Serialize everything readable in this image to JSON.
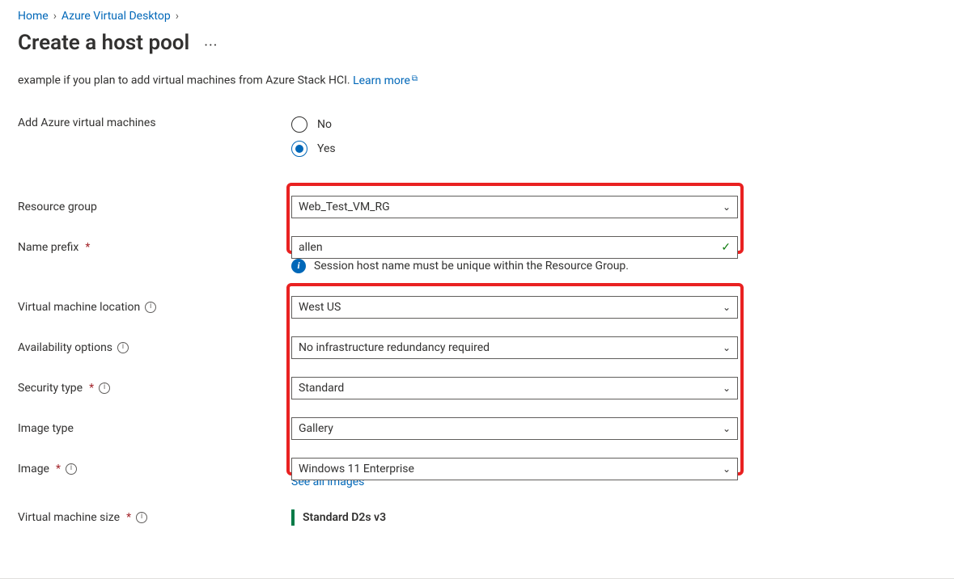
{
  "breadcrumb": {
    "home": "Home",
    "avd": "Azure Virtual Desktop"
  },
  "page_title": "Create a host pool",
  "description": {
    "text": "example if you plan to add virtual machines from Azure Stack HCI. ",
    "link": "Learn more"
  },
  "labels": {
    "add_vms": "Add Azure virtual machines",
    "resource_group": "Resource group",
    "name_prefix": "Name prefix",
    "vm_location": "Virtual machine location",
    "availability": "Availability options",
    "security_type": "Security type",
    "image_type": "Image type",
    "image": "Image",
    "vm_size": "Virtual machine size"
  },
  "radios": {
    "no": "No",
    "yes": "Yes"
  },
  "values": {
    "resource_group": "Web_Test_VM_RG",
    "name_prefix": "allen",
    "vm_location": "West US",
    "availability": "No infrastructure redundancy required",
    "security_type": "Standard",
    "image_type": "Gallery",
    "image": "Windows 11 Enterprise",
    "vm_size": "Standard D2s v3"
  },
  "info_note": "Session host name must be unique within the Resource Group.",
  "see_all_images": "See all images"
}
